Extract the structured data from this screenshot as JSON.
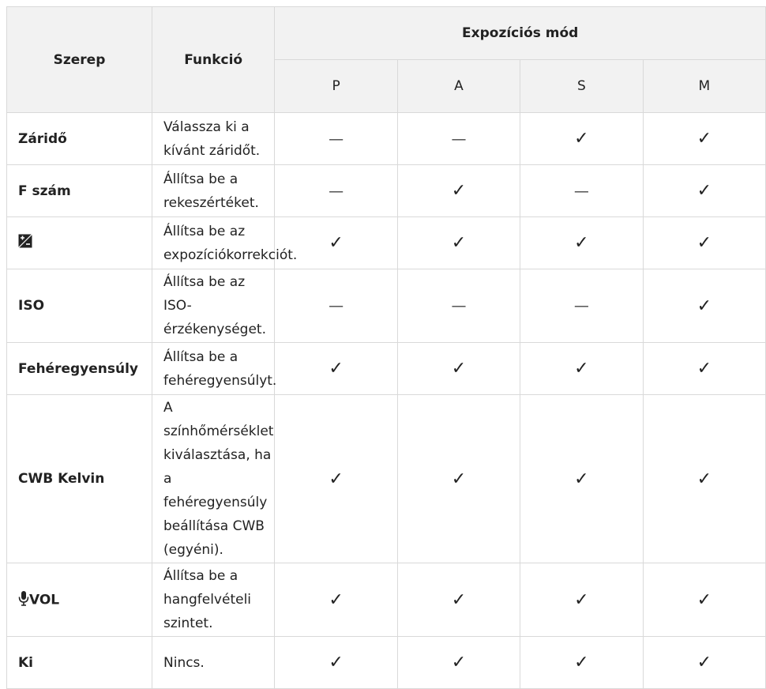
{
  "header": {
    "role": "Szerep",
    "function": "Funkció",
    "mode_group": "Expozíciós mód",
    "modes": [
      "P",
      "A",
      "S",
      "M"
    ]
  },
  "rows": [
    {
      "role": "Záridő",
      "function": "Válassza ki a kívánt záridőt.",
      "marks": [
        "—",
        "—",
        "✓",
        "✓"
      ]
    },
    {
      "role": "F szám",
      "function": "Állítsa be a rekeszértéket.",
      "marks": [
        "—",
        "✓",
        "—",
        "✓"
      ]
    },
    {
      "role": "",
      "role_icon": "exposure-compensation-icon",
      "function": "Állítsa be az expozíciókorrekciót.",
      "marks": [
        "✓",
        "✓",
        "✓",
        "✓"
      ]
    },
    {
      "role": "ISO",
      "function": "Állítsa be az ISO-érzékenységet.",
      "marks": [
        "—",
        "—",
        "—",
        "✓"
      ]
    },
    {
      "role": "Fehéregyensúly",
      "function": "Állítsa be a fehéregyensúlyt.",
      "marks": [
        "✓",
        "✓",
        "✓",
        "✓"
      ]
    },
    {
      "role": "CWB Kelvin",
      "function": "A színhőmérséklet kiválasztása, ha a fehéregyensúly beállítása CWB (egyéni).",
      "marks": [
        "✓",
        "✓",
        "✓",
        "✓"
      ]
    },
    {
      "role": "VOL",
      "role_icon": "microphone-icon",
      "function": "Állítsa be a hangfelvételi szintet.",
      "marks": [
        "✓",
        "✓",
        "✓",
        "✓"
      ]
    },
    {
      "role": "Ki",
      "function": "Nincs.",
      "marks": [
        "✓",
        "✓",
        "✓",
        "✓"
      ]
    }
  ]
}
